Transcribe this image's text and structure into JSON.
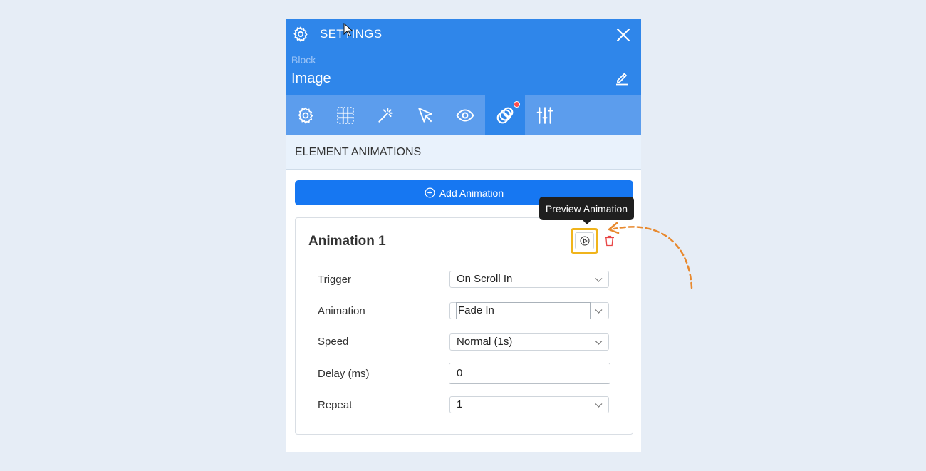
{
  "header": {
    "title": "SETTINGS",
    "block_label": "Block",
    "block_name": "Image"
  },
  "tabs": [
    {
      "icon": "gear-icon",
      "active": false
    },
    {
      "icon": "grid-spacing-icon",
      "active": false
    },
    {
      "icon": "magic-wand-icon",
      "active": false
    },
    {
      "icon": "pointer-icon",
      "active": false
    },
    {
      "icon": "eye-icon",
      "active": false
    },
    {
      "icon": "animation-rings-icon",
      "active": true,
      "badge": true
    },
    {
      "icon": "sliders-icon",
      "active": false
    }
  ],
  "section": {
    "title": "ELEMENT ANIMATIONS"
  },
  "add_button": {
    "label": "Add Animation"
  },
  "animation": {
    "title": "Animation 1",
    "tooltip": "Preview Animation",
    "fields": {
      "trigger": {
        "label": "Trigger",
        "value": "On Scroll In"
      },
      "animation": {
        "label": "Animation",
        "value": "Fade In"
      },
      "speed": {
        "label": "Speed",
        "value": "Normal (1s)"
      },
      "delay": {
        "label": "Delay (ms)",
        "value": "0"
      },
      "repeat": {
        "label": "Repeat",
        "value": "1"
      }
    }
  },
  "colors": {
    "header_bg": "#2f86ea",
    "tabs_bg": "#5c9ded",
    "primary_button": "#1677f2",
    "highlight": "#f0b41c",
    "delete": "#e84545",
    "annotation_arrow": "#e8892e"
  }
}
